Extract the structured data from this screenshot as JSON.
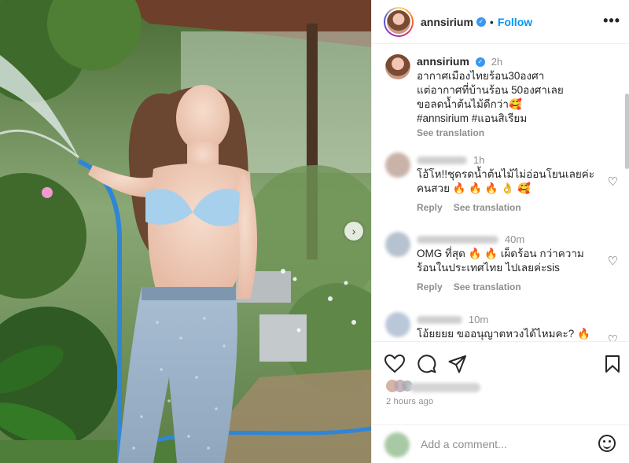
{
  "post": {
    "username": "annsirium",
    "follow_label": "Follow",
    "dot": "•",
    "more_label": "•••"
  },
  "caption": {
    "username": "annsirium",
    "time": "2h",
    "line1": "อากาศเมืองไทยร้อน30องศา",
    "line2": "แต่อากาศที่บ้านร้อน 50องศาเลย",
    "line3": "ขอลดน้ำต้นไม้ดีกว่า🥰",
    "hashtags": "#annsirium #แอนสิเรียม",
    "see_translation": "See translation"
  },
  "comments": [
    {
      "time": "1h",
      "line1": "โอ้โห!!ชุดรดน้ำต้นไม้ไม่อ่อนโยนเลยค่ะ",
      "line2": "คนสวย 🔥 🔥 🔥 👌 🥰",
      "reply": "Reply",
      "see_translation": "See translation"
    },
    {
      "time": "40m",
      "line1": "OMG ที่สุด 🔥 🔥 เผ็ดร้อน กว่าความ",
      "line2": "ร้อนในประเทศไทย ไปเลยค่ะsis",
      "reply": "Reply",
      "see_translation": "See translation"
    },
    {
      "time": "10m",
      "line1": "โอ้ยยยย ขออนุญาตหวงได้ไหมคะ? 🔥"
    }
  ],
  "footer": {
    "ago": "2 hours ago",
    "add_comment_placeholder": "Add a comment..."
  },
  "icons": {
    "next": "›",
    "heart": "♡",
    "verified": "✓"
  },
  "colors": {
    "accent": "#0095f6",
    "text": "#262626",
    "muted": "#8e8e8e",
    "hashtag": "#00376b",
    "verified": "#3897f0"
  }
}
